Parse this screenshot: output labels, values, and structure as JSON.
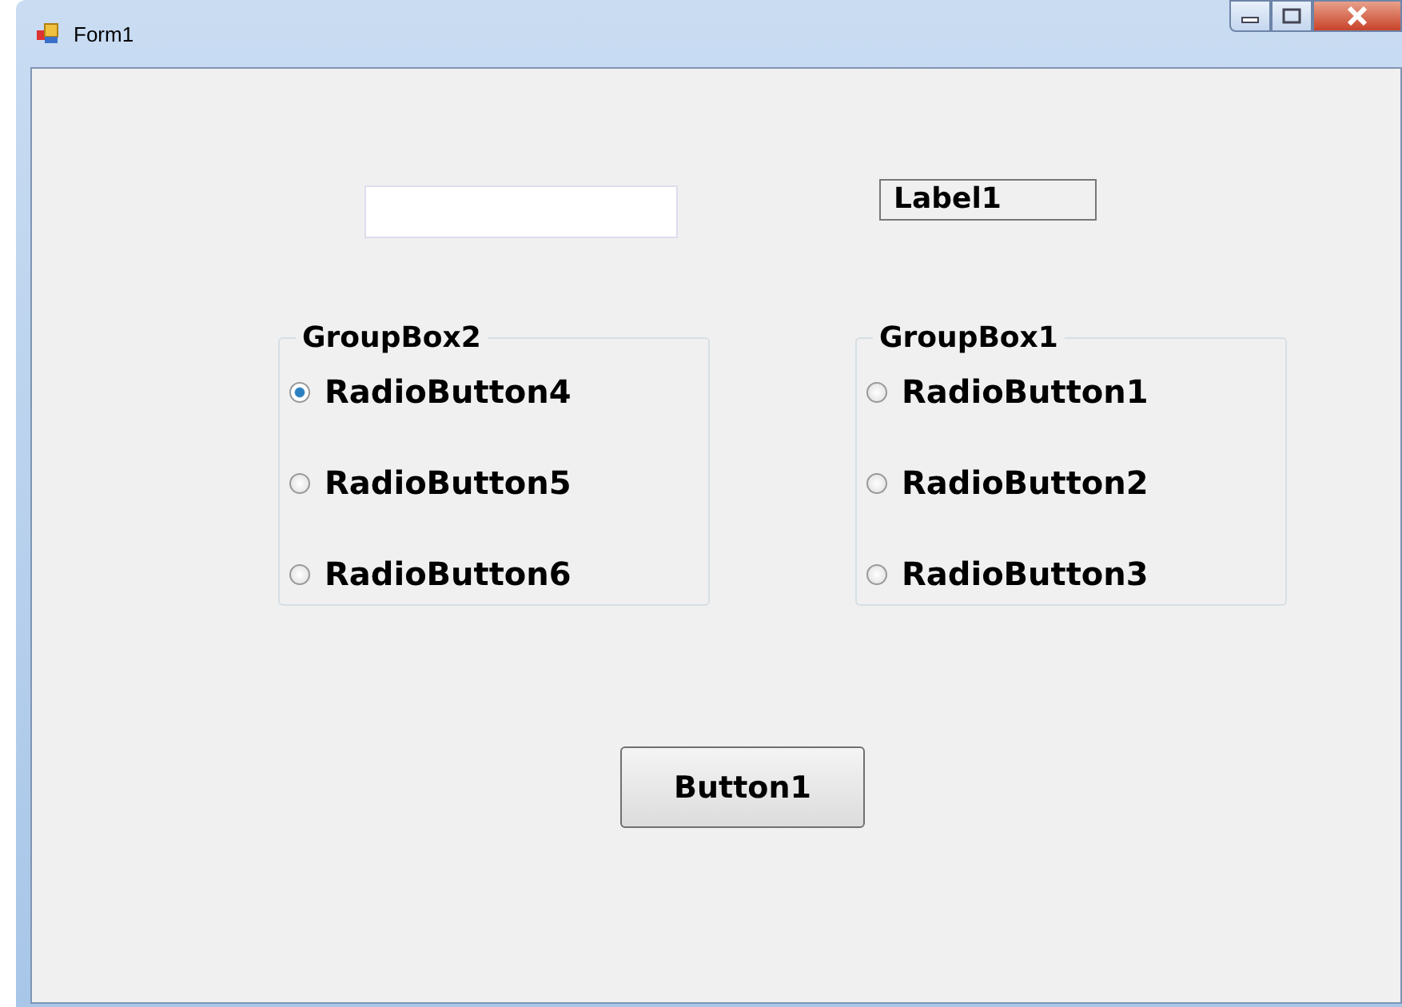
{
  "window": {
    "title": "Form1"
  },
  "label": "Label1",
  "group_boxes": [
    {
      "title": "GroupBox2",
      "radios": [
        {
          "label": "RadioButton4",
          "selected": true
        },
        {
          "label": "RadioButton5",
          "selected": false
        },
        {
          "label": "RadioButton6",
          "selected": false
        }
      ]
    },
    {
      "title": "GroupBox1",
      "radios": [
        {
          "label": "RadioButton1",
          "selected": false
        },
        {
          "label": "RadioButton2",
          "selected": false
        },
        {
          "label": "RadioButton3",
          "selected": false
        }
      ]
    }
  ],
  "button": "Button1"
}
